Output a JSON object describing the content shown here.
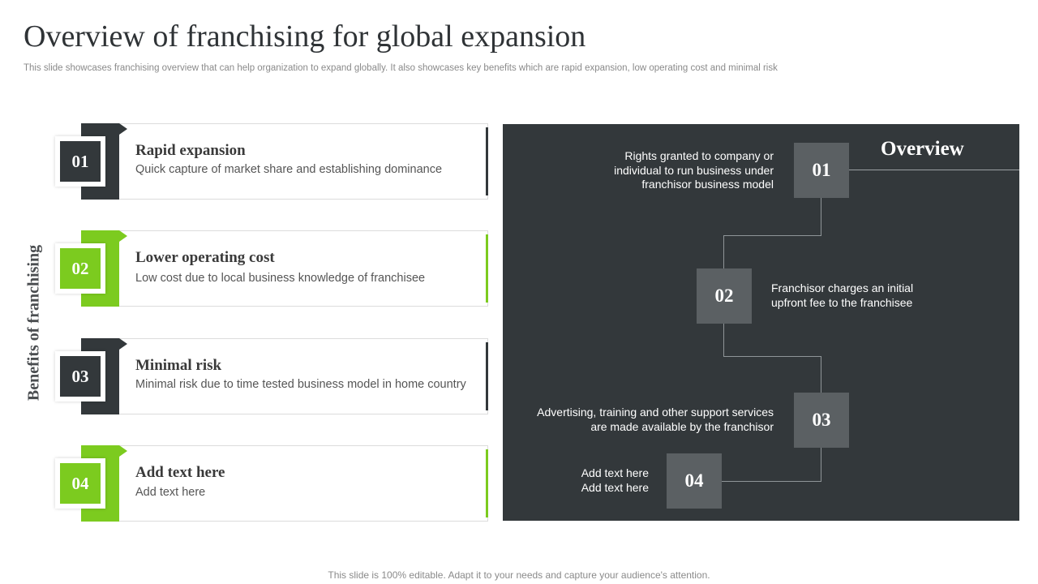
{
  "slide": {
    "title": "Overview of franchising for global expansion",
    "subtitle": "This slide showcases franchising overview that can help organization to expand globally. It also showcases key benefits which are rapid expansion, low operating cost and minimal risk",
    "side_label": "Benefits of franchising",
    "footer": "This slide is 100% editable. Adapt it to your needs and capture your audience's attention."
  },
  "benefits": [
    {
      "number": "01",
      "title": "Rapid expansion",
      "description": "Quick capture of market share and establishing dominance"
    },
    {
      "number": "02",
      "title": "Lower operating cost",
      "description": "Low cost due to local business knowledge of franchisee"
    },
    {
      "number": "03",
      "title": "Minimal risk",
      "description": "Minimal risk due to time tested business model in home country"
    },
    {
      "number": "04",
      "title": "Add text here",
      "description": "Add text here"
    }
  ],
  "overview": {
    "title": "Overview",
    "items": [
      {
        "number": "01",
        "text": "Rights granted to company or individual to run business under franchisor business model"
      },
      {
        "number": "02",
        "text": "Franchisor charges an initial upfront fee to the franchisee"
      },
      {
        "number": "03",
        "text": "Advertising, training and other support services are made available by the franchisor"
      },
      {
        "number": "04",
        "text": "Add text here Add text here"
      }
    ]
  },
  "colors": {
    "dark": "#33383b",
    "green": "#7ccb1f",
    "box": "#5b6063"
  }
}
